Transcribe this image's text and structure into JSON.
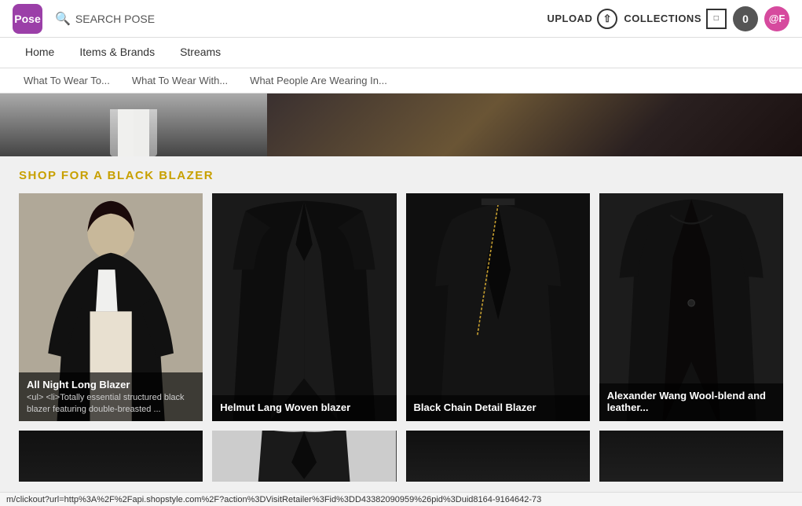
{
  "header": {
    "logo_text": "Pose",
    "search_placeholder": "SEARCH POSE",
    "upload_label": "UPLOAD",
    "collections_label": "COLLECTIONS",
    "count": "0",
    "user_handle": "@F"
  },
  "nav": {
    "items": [
      {
        "label": "Home",
        "active": false
      },
      {
        "label": "Items & Brands",
        "active": false
      },
      {
        "label": "Streams",
        "active": false
      }
    ]
  },
  "sub_nav": {
    "items": [
      {
        "label": "What To Wear To..."
      },
      {
        "label": "What To Wear With..."
      },
      {
        "label": "What People Are Wearing In..."
      }
    ]
  },
  "shop_section": {
    "title": "SHOP FOR A BLACK BLAZER"
  },
  "products": [
    {
      "name": "All Night Long Blazer",
      "desc": "<ul> <li>Totally essential structured black blazer featuring double-breasted ...",
      "has_overlay": true
    },
    {
      "name": "Helmut Lang Woven blazer",
      "desc": "",
      "has_overlay": true
    },
    {
      "name": "Black Chain Detail Blazer",
      "desc": "",
      "has_overlay": true
    },
    {
      "name": "Alexander Wang Wool-blend and leather...",
      "desc": "",
      "has_overlay": true
    },
    {
      "name": "",
      "desc": "",
      "has_overlay": false
    },
    {
      "name": "",
      "desc": "",
      "has_overlay": false
    },
    {
      "name": "",
      "desc": "",
      "has_overlay": false
    },
    {
      "name": "",
      "desc": "",
      "has_overlay": false
    }
  ],
  "status_bar": {
    "url": "m/clickout?url=http%3A%2F%2Fapi.shopstyle.com%2F?action%3DVisitRetailer%3Fid%3DD43382090959%26pid%3Duid8164-9164642-73"
  }
}
